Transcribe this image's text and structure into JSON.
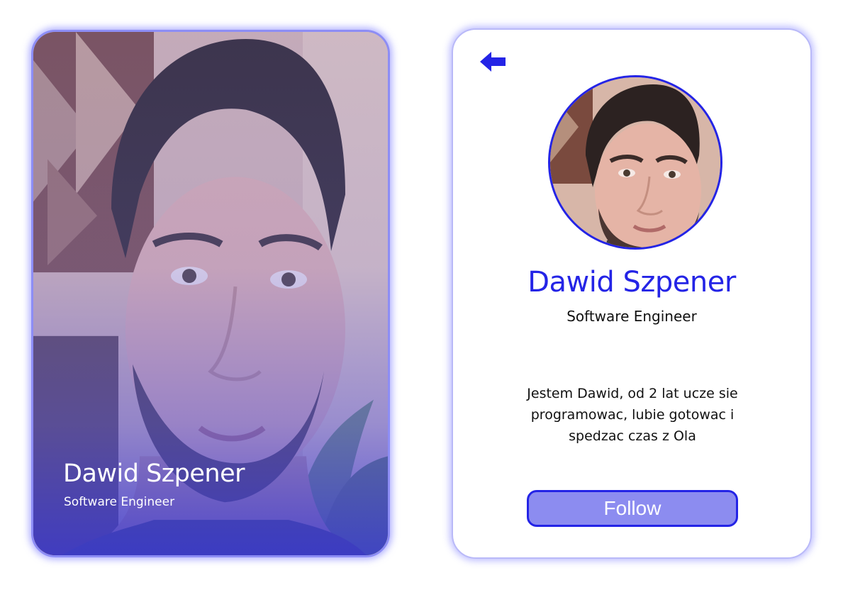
{
  "photo_card": {
    "name": "Dawid Szpener",
    "role": "Software Engineer"
  },
  "profile_card": {
    "back_icon": "arrow-left-icon",
    "name": "Dawid Szpener",
    "role": "Software Engineer",
    "bio": "Jestem Dawid, od 2 lat ucze sie programowac, lubie gotowac i spedzac czas z Ola",
    "follow_label": "Follow"
  },
  "colors": {
    "accent": "#2424e6",
    "button_fill": "#8c8cf0",
    "card_glow": "#8d8df5"
  }
}
